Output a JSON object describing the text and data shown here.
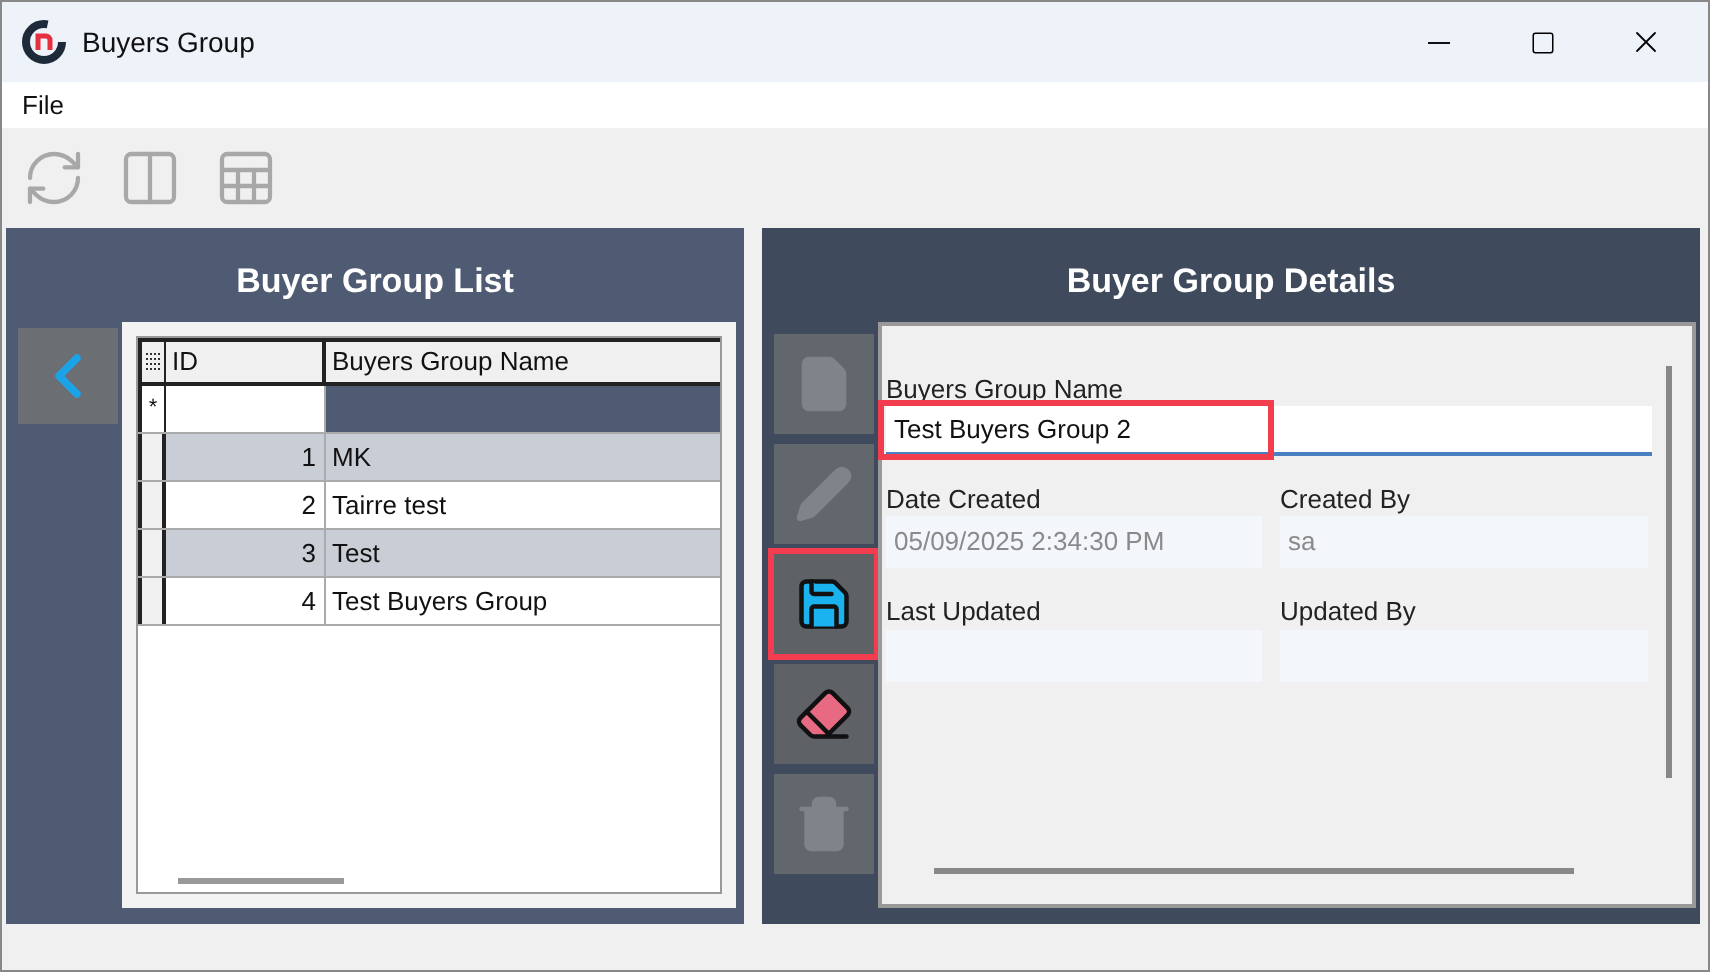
{
  "window": {
    "title": "Buyers Group"
  },
  "menu": [
    "File"
  ],
  "toolbar": [
    {
      "kind": "refresh",
      "disabled": true
    },
    {
      "kind": "layout",
      "disabled": true
    },
    {
      "kind": "excel",
      "disabled": true
    }
  ],
  "list_panel": {
    "title": "Buyer Group List",
    "columns": [
      "ID",
      "Buyers Group Name"
    ],
    "new_row_marker": "*",
    "rows": [
      {
        "id": "1",
        "name": "MK",
        "shaded": true
      },
      {
        "id": "2",
        "name": "Tairre test",
        "shaded": false
      },
      {
        "id": "3",
        "name": "Test",
        "shaded": true
      },
      {
        "id": "4",
        "name": "Test Buyers Group",
        "shaded": false
      }
    ]
  },
  "details_panel": {
    "title": "Buyer Group Details",
    "actions": [
      {
        "kind": "new",
        "disabled": true,
        "highlighted": false
      },
      {
        "kind": "edit",
        "disabled": true,
        "highlighted": false
      },
      {
        "kind": "save",
        "disabled": false,
        "highlighted": true
      },
      {
        "kind": "clear",
        "disabled": false,
        "highlighted": false
      },
      {
        "kind": "delete",
        "disabled": true,
        "highlighted": false
      }
    ],
    "name_field": {
      "label": "Buyers Group Name",
      "value": "Test Buyers Group 2",
      "highlighted": true
    },
    "fields": [
      {
        "label": "Date Created",
        "value": "05/09/2025 2:34:30 PM"
      },
      {
        "label": "Created By",
        "value": "sa"
      },
      {
        "label": "Last Updated"
      },
      {
        "label": "Updated By"
      }
    ]
  }
}
